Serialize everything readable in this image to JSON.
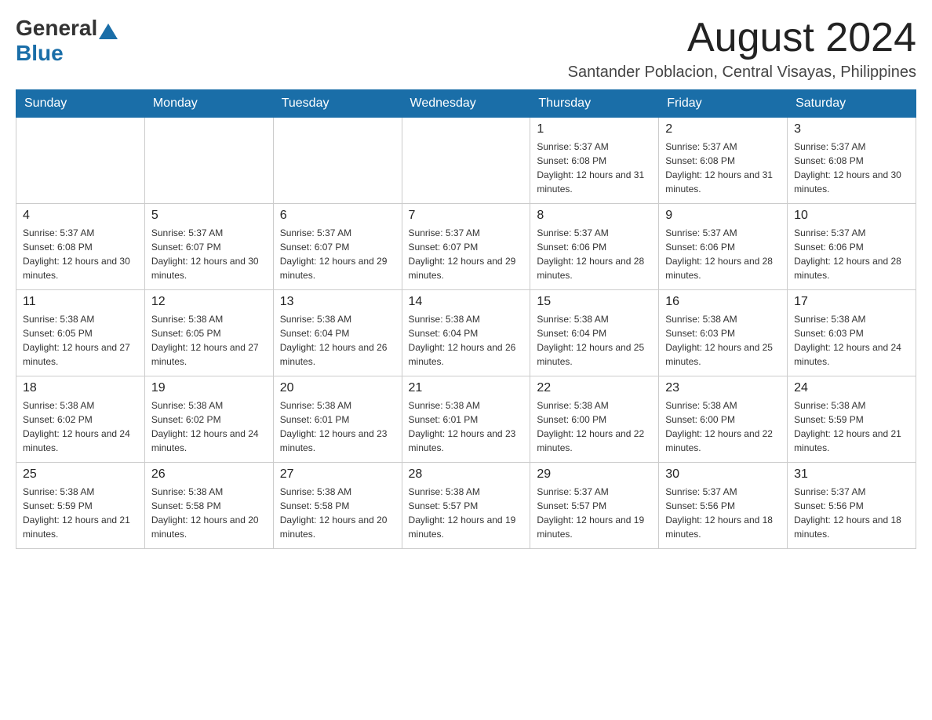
{
  "header": {
    "logo": {
      "general": "General",
      "blue": "Blue"
    },
    "title": "August 2024",
    "subtitle": "Santander Poblacion, Central Visayas, Philippines"
  },
  "calendar": {
    "days_of_week": [
      "Sunday",
      "Monday",
      "Tuesday",
      "Wednesday",
      "Thursday",
      "Friday",
      "Saturday"
    ],
    "weeks": [
      {
        "cells": [
          {
            "day": "",
            "info": ""
          },
          {
            "day": "",
            "info": ""
          },
          {
            "day": "",
            "info": ""
          },
          {
            "day": "",
            "info": ""
          },
          {
            "day": "1",
            "info": "Sunrise: 5:37 AM\nSunset: 6:08 PM\nDaylight: 12 hours and 31 minutes."
          },
          {
            "day": "2",
            "info": "Sunrise: 5:37 AM\nSunset: 6:08 PM\nDaylight: 12 hours and 31 minutes."
          },
          {
            "day": "3",
            "info": "Sunrise: 5:37 AM\nSunset: 6:08 PM\nDaylight: 12 hours and 30 minutes."
          }
        ]
      },
      {
        "cells": [
          {
            "day": "4",
            "info": "Sunrise: 5:37 AM\nSunset: 6:08 PM\nDaylight: 12 hours and 30 minutes."
          },
          {
            "day": "5",
            "info": "Sunrise: 5:37 AM\nSunset: 6:07 PM\nDaylight: 12 hours and 30 minutes."
          },
          {
            "day": "6",
            "info": "Sunrise: 5:37 AM\nSunset: 6:07 PM\nDaylight: 12 hours and 29 minutes."
          },
          {
            "day": "7",
            "info": "Sunrise: 5:37 AM\nSunset: 6:07 PM\nDaylight: 12 hours and 29 minutes."
          },
          {
            "day": "8",
            "info": "Sunrise: 5:37 AM\nSunset: 6:06 PM\nDaylight: 12 hours and 28 minutes."
          },
          {
            "day": "9",
            "info": "Sunrise: 5:37 AM\nSunset: 6:06 PM\nDaylight: 12 hours and 28 minutes."
          },
          {
            "day": "10",
            "info": "Sunrise: 5:37 AM\nSunset: 6:06 PM\nDaylight: 12 hours and 28 minutes."
          }
        ]
      },
      {
        "cells": [
          {
            "day": "11",
            "info": "Sunrise: 5:38 AM\nSunset: 6:05 PM\nDaylight: 12 hours and 27 minutes."
          },
          {
            "day": "12",
            "info": "Sunrise: 5:38 AM\nSunset: 6:05 PM\nDaylight: 12 hours and 27 minutes."
          },
          {
            "day": "13",
            "info": "Sunrise: 5:38 AM\nSunset: 6:04 PM\nDaylight: 12 hours and 26 minutes."
          },
          {
            "day": "14",
            "info": "Sunrise: 5:38 AM\nSunset: 6:04 PM\nDaylight: 12 hours and 26 minutes."
          },
          {
            "day": "15",
            "info": "Sunrise: 5:38 AM\nSunset: 6:04 PM\nDaylight: 12 hours and 25 minutes."
          },
          {
            "day": "16",
            "info": "Sunrise: 5:38 AM\nSunset: 6:03 PM\nDaylight: 12 hours and 25 minutes."
          },
          {
            "day": "17",
            "info": "Sunrise: 5:38 AM\nSunset: 6:03 PM\nDaylight: 12 hours and 24 minutes."
          }
        ]
      },
      {
        "cells": [
          {
            "day": "18",
            "info": "Sunrise: 5:38 AM\nSunset: 6:02 PM\nDaylight: 12 hours and 24 minutes."
          },
          {
            "day": "19",
            "info": "Sunrise: 5:38 AM\nSunset: 6:02 PM\nDaylight: 12 hours and 24 minutes."
          },
          {
            "day": "20",
            "info": "Sunrise: 5:38 AM\nSunset: 6:01 PM\nDaylight: 12 hours and 23 minutes."
          },
          {
            "day": "21",
            "info": "Sunrise: 5:38 AM\nSunset: 6:01 PM\nDaylight: 12 hours and 23 minutes."
          },
          {
            "day": "22",
            "info": "Sunrise: 5:38 AM\nSunset: 6:00 PM\nDaylight: 12 hours and 22 minutes."
          },
          {
            "day": "23",
            "info": "Sunrise: 5:38 AM\nSunset: 6:00 PM\nDaylight: 12 hours and 22 minutes."
          },
          {
            "day": "24",
            "info": "Sunrise: 5:38 AM\nSunset: 5:59 PM\nDaylight: 12 hours and 21 minutes."
          }
        ]
      },
      {
        "cells": [
          {
            "day": "25",
            "info": "Sunrise: 5:38 AM\nSunset: 5:59 PM\nDaylight: 12 hours and 21 minutes."
          },
          {
            "day": "26",
            "info": "Sunrise: 5:38 AM\nSunset: 5:58 PM\nDaylight: 12 hours and 20 minutes."
          },
          {
            "day": "27",
            "info": "Sunrise: 5:38 AM\nSunset: 5:58 PM\nDaylight: 12 hours and 20 minutes."
          },
          {
            "day": "28",
            "info": "Sunrise: 5:38 AM\nSunset: 5:57 PM\nDaylight: 12 hours and 19 minutes."
          },
          {
            "day": "29",
            "info": "Sunrise: 5:37 AM\nSunset: 5:57 PM\nDaylight: 12 hours and 19 minutes."
          },
          {
            "day": "30",
            "info": "Sunrise: 5:37 AM\nSunset: 5:56 PM\nDaylight: 12 hours and 18 minutes."
          },
          {
            "day": "31",
            "info": "Sunrise: 5:37 AM\nSunset: 5:56 PM\nDaylight: 12 hours and 18 minutes."
          }
        ]
      }
    ]
  }
}
